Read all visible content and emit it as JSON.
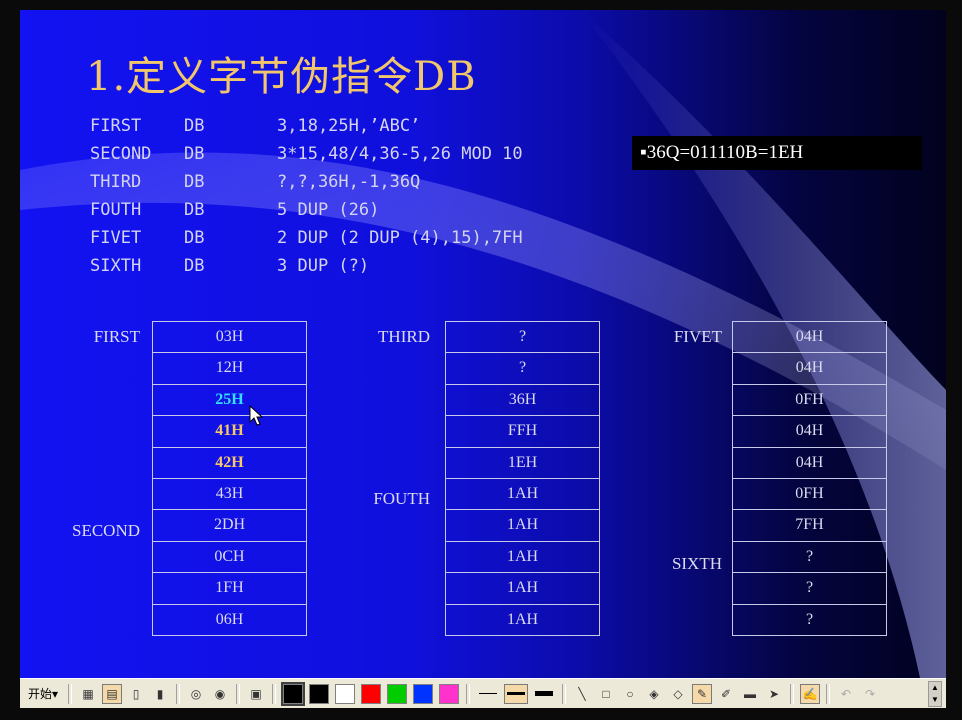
{
  "title": "1.定义字节伪指令DB",
  "code": [
    {
      "label": "FIRST",
      "op": "DB",
      "args": "3,18,25H,’ABC’"
    },
    {
      "label": "SECOND",
      "op": "DB",
      "args": "3*15,48/4,36-5,26 MOD 10"
    },
    {
      "label": "THIRD",
      "op": "DB",
      "args": "?,?,36H,-1,36Q"
    },
    {
      "label": "FOUTH",
      "op": "DB",
      "args": "5 DUP (26)"
    },
    {
      "label": "FIVET",
      "op": "DB",
      "args": "2 DUP (2 DUP (4),15),7FH"
    },
    {
      "label": "SIXTH",
      "op": "DB",
      "args": "3 DUP (?)"
    }
  ],
  "note": "▪36Q=011110B=1EH",
  "tables": [
    {
      "cells": [
        {
          "value": "03H"
        },
        {
          "value": "12H"
        },
        {
          "value": "25H",
          "highlight": "cyan"
        },
        {
          "value": "41H",
          "highlight": "gold"
        },
        {
          "value": "42H",
          "highlight": "gold"
        },
        {
          "value": "43H"
        },
        {
          "value": "2DH"
        },
        {
          "value": "0CH"
        },
        {
          "value": "1FH"
        },
        {
          "value": "06H"
        }
      ],
      "labels": [
        {
          "text": "FIRST",
          "row": 0
        },
        {
          "text": "SECOND",
          "row": 6
        }
      ]
    },
    {
      "cells": [
        {
          "value": "?"
        },
        {
          "value": "?"
        },
        {
          "value": "36H"
        },
        {
          "value": "FFH"
        },
        {
          "value": "1EH"
        },
        {
          "value": "1AH"
        },
        {
          "value": "1AH"
        },
        {
          "value": "1AH"
        },
        {
          "value": "1AH"
        },
        {
          "value": "1AH"
        }
      ],
      "labels": [
        {
          "text": "THIRD",
          "row": 0
        },
        {
          "text": "FOUTH",
          "row": 5
        }
      ]
    },
    {
      "cells": [
        {
          "value": "04H"
        },
        {
          "value": "04H"
        },
        {
          "value": "0FH"
        },
        {
          "value": "04H"
        },
        {
          "value": "04H"
        },
        {
          "value": "0FH"
        },
        {
          "value": "7FH"
        },
        {
          "value": "?"
        },
        {
          "value": "?"
        },
        {
          "value": "?"
        }
      ],
      "labels": [
        {
          "text": "FIVET",
          "row": 0
        },
        {
          "text": "SIXTH",
          "row": 7
        }
      ]
    }
  ],
  "toolbar": {
    "start_label": "开始▾",
    "pen_colors": [
      "#000000",
      "#000000",
      "#ffffff",
      "#ff0000",
      "#00cc00",
      "#0033ff",
      "#ff33cc"
    ]
  }
}
